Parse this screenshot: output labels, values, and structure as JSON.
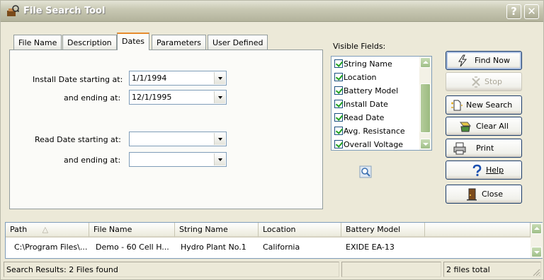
{
  "window": {
    "title": "File Search Tool",
    "help_glyph": "?",
    "close_glyph": "✕"
  },
  "tabs": [
    {
      "label": "File Name",
      "active": false
    },
    {
      "label": "Description",
      "active": false
    },
    {
      "label": "Dates",
      "active": true
    },
    {
      "label": "Parameters",
      "active": false
    },
    {
      "label": "User Defined",
      "active": false
    }
  ],
  "dates": {
    "install_start_label": "Install Date starting at:",
    "install_start_value": "1/1/1994",
    "install_end_label": "and ending at:",
    "install_end_value": "12/1/1995",
    "read_start_label": "Read Date starting at:",
    "read_start_value": "",
    "read_end_label": "and ending at:",
    "read_end_value": ""
  },
  "visible_fields": {
    "label": "Visible Fields:",
    "items": [
      {
        "label": "String Name",
        "checked": true
      },
      {
        "label": "Location",
        "checked": true
      },
      {
        "label": "Battery Model",
        "checked": true
      },
      {
        "label": "Install Date",
        "checked": true
      },
      {
        "label": "Read Date",
        "checked": true
      },
      {
        "label": "Avg. Resistance",
        "checked": true
      },
      {
        "label": "Overall Voltage",
        "checked": true
      }
    ]
  },
  "buttons": {
    "find_now": "Find Now",
    "stop": "Stop",
    "new_search": "New Search",
    "clear_all": "Clear All",
    "print": "Print",
    "help": "Help",
    "close": "Close"
  },
  "results": {
    "columns": [
      "Path",
      "File Name",
      "String Name",
      "Location",
      "Battery Model"
    ],
    "sort_indicator": "△",
    "rows": [
      [
        "C:\\Program Files\\...",
        "Demo - 60 Cell H...",
        "Hydro Plant No.1",
        "California",
        "EXIDE EA-13"
      ]
    ]
  },
  "status": {
    "message": "Search Results: 2 Files found",
    "total": "2 files total"
  },
  "colors": {
    "accent_tab": "#e68b2c",
    "checkmark": "#21a121",
    "scroll_green": "#9fbf88"
  }
}
